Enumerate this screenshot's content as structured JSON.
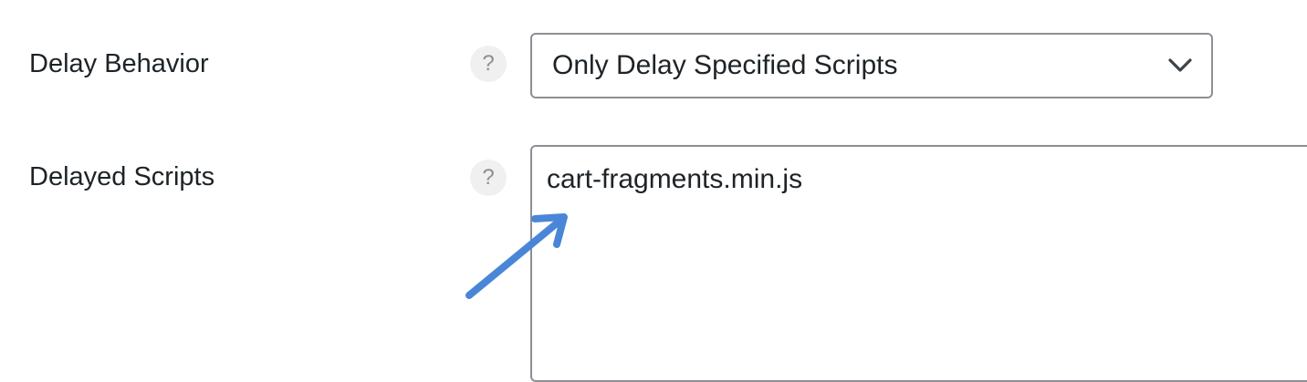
{
  "settings": {
    "delay_behavior": {
      "label": "Delay Behavior",
      "help_glyph": "?",
      "selected": "Only Delay Specified Scripts"
    },
    "delayed_scripts": {
      "label": "Delayed Scripts",
      "help_glyph": "?",
      "value": "cart-fragments.min.js"
    }
  },
  "colors": {
    "accent_arrow": "#4a86d8",
    "text": "#1d2327",
    "border": "#8c8f94",
    "help_bg": "#f0f0f1"
  },
  "icons": {
    "help": "help-icon",
    "dropdown": "chevron-down-icon",
    "annotation": "arrow-annotation-icon"
  }
}
